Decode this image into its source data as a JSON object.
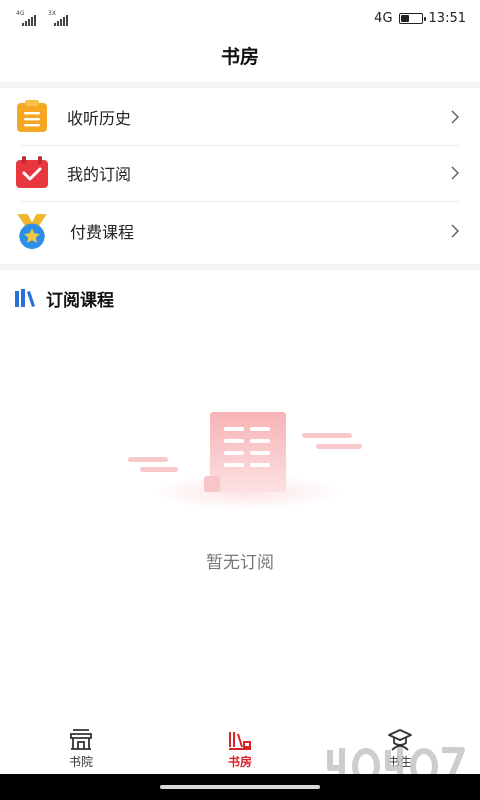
{
  "status_bar": {
    "sim1_tag": "4G",
    "sim2_tag": "3X",
    "network": "4G",
    "time": "13:51",
    "battery_level": 0.4
  },
  "header": {
    "title": "书房"
  },
  "menu": [
    {
      "label": "收听历史",
      "icon": "clipboard-icon",
      "color": "#f5a623"
    },
    {
      "label": "我的订阅",
      "icon": "calendar-check-icon",
      "color": "#e8383d"
    },
    {
      "label": "付费课程",
      "icon": "medal-star-icon",
      "color": "#2b8ee8"
    }
  ],
  "section": {
    "title": "订阅课程",
    "icon": "books-icon",
    "color": "#2a6fd8"
  },
  "empty_state": {
    "text": "暂无订阅",
    "icon": "document-illustration-icon"
  },
  "tabbar": {
    "tabs": [
      {
        "label": "书院",
        "icon": "building-icon",
        "active": false
      },
      {
        "label": "书房",
        "icon": "bookshelf-icon",
        "active": true
      },
      {
        "label": "书生",
        "icon": "graduate-icon",
        "active": false
      }
    ],
    "active_color": "#d8232a"
  },
  "colors": {
    "accent": "#d8232a",
    "background": "#ffffff",
    "separator": "#f4f4f4"
  }
}
